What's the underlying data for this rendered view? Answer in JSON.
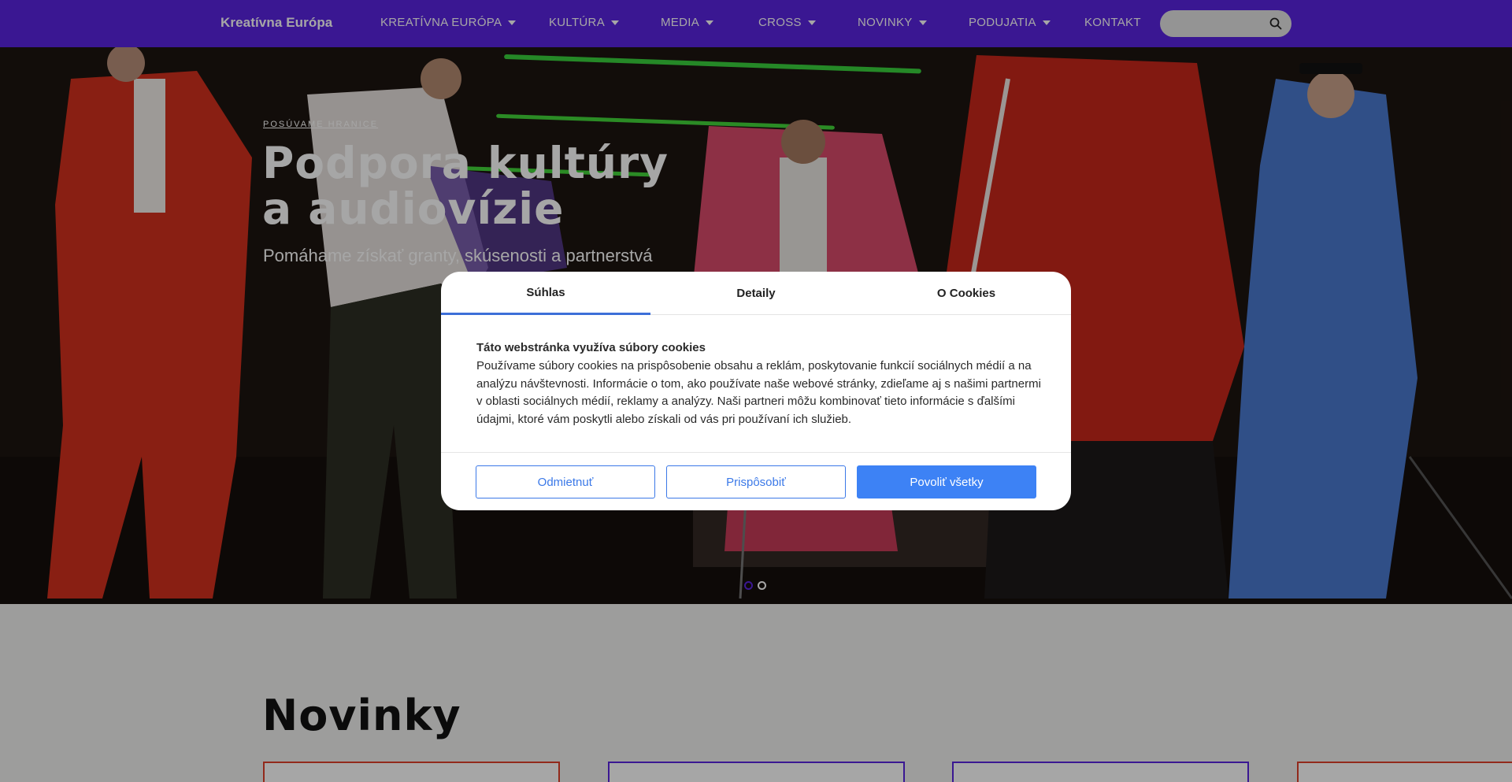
{
  "nav": {
    "brand": "Kreatívna Európa",
    "items": [
      {
        "label": "KREATÍVNA EURÓPA",
        "has_dropdown": true
      },
      {
        "label": "KULTÚRA",
        "has_dropdown": true
      },
      {
        "label": "MEDIA",
        "has_dropdown": true
      },
      {
        "label": "CROSS",
        "has_dropdown": true
      },
      {
        "label": "NOVINKY",
        "has_dropdown": true
      },
      {
        "label": "PODUJATIA",
        "has_dropdown": true
      },
      {
        "label": "KONTAKT",
        "has_dropdown": false
      }
    ],
    "search": {
      "placeholder": "",
      "icon": "search-icon"
    }
  },
  "hero": {
    "tagline": "POSÚVAME HRANICE",
    "title_line1": "Podpora kultúry",
    "title_line2": "a audiovízie",
    "subtitle": "Pomáhame získať granty, skúsenosti a partnerstvá",
    "slides": {
      "count": 2,
      "active": 1
    }
  },
  "news": {
    "heading": "Novinky",
    "card_border_colors": [
      "#e0402a",
      "#5a24e0",
      "#5a24e0",
      "#e0402a"
    ]
  },
  "cookie_modal": {
    "tabs": [
      {
        "label": "Súhlas",
        "active": true
      },
      {
        "label": "Detaily",
        "active": false
      },
      {
        "label": "O Cookies",
        "active": false
      }
    ],
    "title": "Táto webstránka využíva súbory cookies",
    "text": "Používame súbory cookies na prispôsobenie obsahu a reklám, poskytovanie funkcií sociálnych médií a na analýzu návštevnosti. Informácie o tom, ako používate naše webové stránky, zdieľame aj s našimi partnermi v oblasti sociálnych médií, reklamy a analýzy. Naši partneri môžu kombinovať tieto informácie s ďalšími údajmi, ktoré vám poskytli alebo získali od vás pri používaní ich služieb.",
    "buttons": {
      "reject": "Odmietnuť",
      "customize": "Prispôsobiť",
      "accept_all": "Povoliť všetky"
    }
  },
  "colors": {
    "nav_bg": "#5a24e0",
    "accent_blue": "#3d82f5",
    "tab_underline": "#3c6fd8"
  }
}
